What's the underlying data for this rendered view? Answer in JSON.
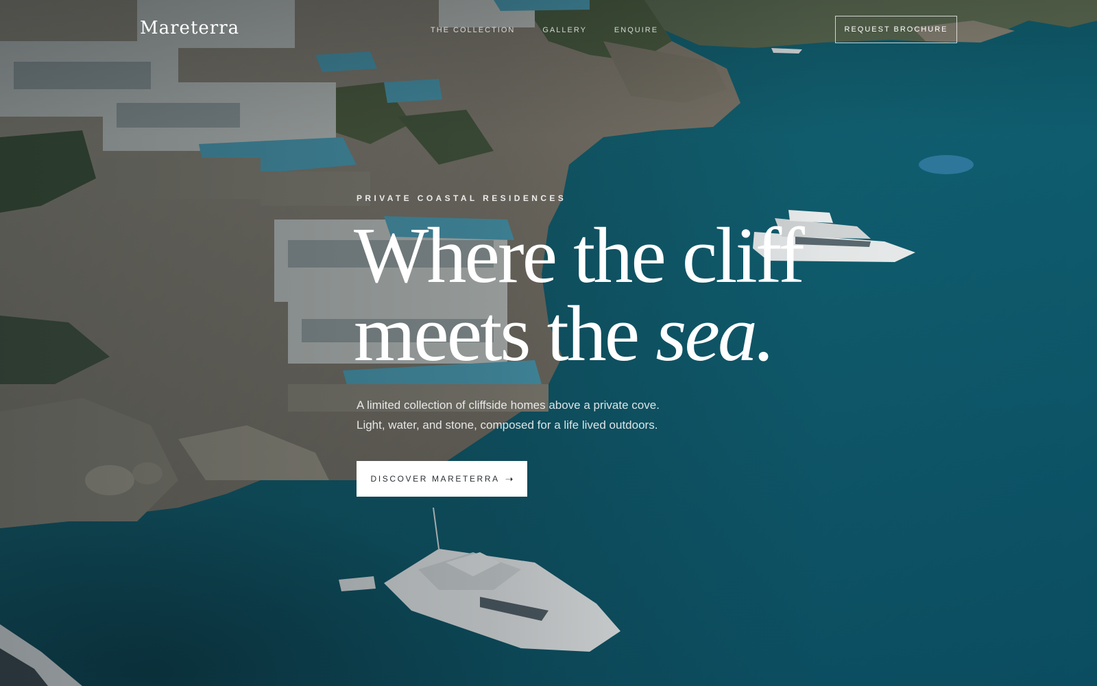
{
  "brand": {
    "logo": "Mareterra"
  },
  "nav": {
    "links": [
      "THE COLLECTION",
      "GALLERY",
      "ENQUIRE"
    ],
    "brochure_label": "REQUEST BROCHURE"
  },
  "hero": {
    "eyebrow": "PRIVATE COASTAL RESIDENCES",
    "headline_line1": "Where the cliff",
    "headline_line2_prefix": "meets the ",
    "headline_line2_emphasis": "sea.",
    "sub_line1": "A limited collection of cliffside homes above a private cove.",
    "sub_line2": "Light, water, and stone, composed for a life lived outdoors.",
    "cta_label": "DISCOVER MARETERRA",
    "cta_icon": "arrow-right-icon"
  },
  "colors": {
    "sea": "#0e5a6a",
    "cliff": "#8a8173",
    "cta_background": "#ffffff",
    "cta_text": "#2b2f33"
  }
}
